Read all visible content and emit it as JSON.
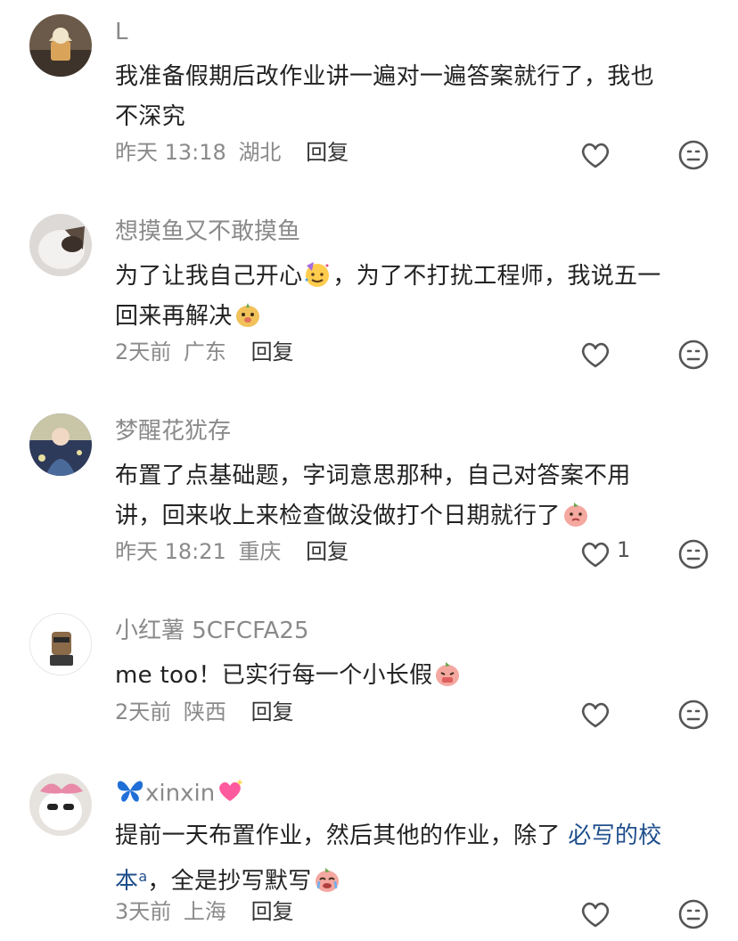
{
  "comments": [
    {
      "username": "L",
      "content_parts": [
        "我准备假期后改作业讲一遍对一遍答案就行了，我也",
        "不深究"
      ],
      "time": "昨天 13:18",
      "location": "湖北",
      "reply_label": "回复",
      "likes": ""
    },
    {
      "username": "想摸鱼又不敢摸鱼",
      "content_a": "为了让我自己开心",
      "content_b": "，为了不打扰工程师，我说五一",
      "content_c": "回来再解决",
      "time": "2天前",
      "location": "广东",
      "reply_label": "回复",
      "likes": ""
    },
    {
      "username": "梦醒花犹存",
      "content_a": "布置了点基础题，字词意思那种，自己对答案不用",
      "content_b": "讲，回来收上来检查做没做打个日期就行了",
      "time": "昨天 18:21",
      "location": "重庆",
      "reply_label": "回复",
      "likes": "1"
    },
    {
      "username": "小红薯 5CFCFA25",
      "content_a": "me too！已实行每一个小长假",
      "time": "2天前",
      "location": "陕西",
      "reply_label": "回复",
      "likes": ""
    },
    {
      "username": "xinxin",
      "content_a": "提前一天布置作业，然后其他的作业，除了 ",
      "link_text_1": "必写的校",
      "link_text_2": "本",
      "content_b": "，全是抄写默写",
      "time": "3天前",
      "location": "上海",
      "reply_label": "回复",
      "likes": ""
    }
  ],
  "icons": {
    "like": "heart-outline-icon",
    "dislike": "meh-face-icon",
    "search_link": "search-mini-icon"
  },
  "colors": {
    "meta_gray": "#8a8a8a",
    "text": "#222222",
    "link": "#1f4f8c"
  }
}
